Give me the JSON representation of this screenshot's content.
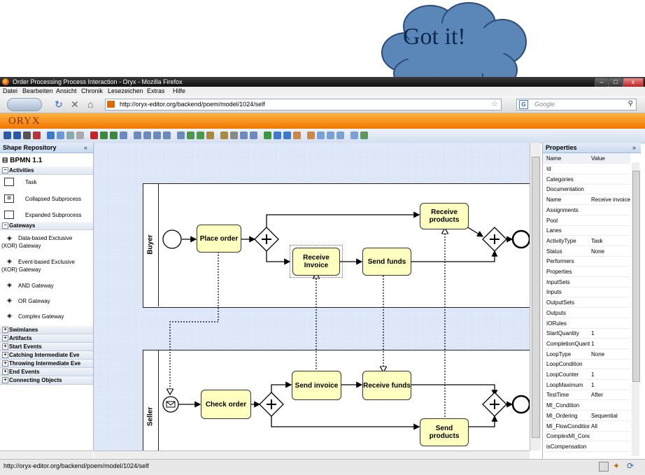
{
  "overlay": {
    "cloud_text": "Got it!"
  },
  "window": {
    "title": "Order Processing Process Interaction - Oryx - Mozilla Firefox",
    "min": "–",
    "max": "□",
    "close": "x"
  },
  "menu": [
    "Datei",
    "Bearbeiten",
    "Ansicht",
    "Chronik",
    "Lesezeichen",
    "Extras",
    "Hilfe"
  ],
  "nav": {
    "url": "http://oryx-editor.org/backend/poem/model/1024/self",
    "search_placeholder": "Google",
    "search_engine": "G"
  },
  "app": {
    "logo": "ORYX"
  },
  "repo": {
    "title": "Shape Repository",
    "collapse": "«",
    "stencil": "BPMN 1.1",
    "sections": {
      "activities": "Activities",
      "gateways": "Gateways",
      "swimlanes": "Swimlanes",
      "artifacts": "Artifacts",
      "start": "Start Events",
      "catching": "Catching Intermediate Eve",
      "throwing": "Throwing Intermediate Eve",
      "end": "End Events",
      "connecting": "Connecting Objects"
    },
    "activity_items": [
      "Task",
      "Collapsed Subprocess",
      "Expanded Subprocess"
    ],
    "gateway_items": [
      "Data-based Exclusive",
      "(XOR) Gateway",
      "Event-based Exclusive",
      "(XOR) Gateway",
      "AND Gateway",
      "OR Gateway",
      "Complex Gateway"
    ]
  },
  "diagram": {
    "pools": [
      "Buyer",
      "Seller"
    ],
    "tasks": {
      "place_order": "Place order",
      "receive_invoice": "Receive Invoice",
      "send_funds": "Send funds",
      "receive_products": "Receive products",
      "check_order": "Check order",
      "send_invoice": "Send invoice",
      "receive_funds": "Receive funds",
      "send_products": "Send products"
    }
  },
  "properties": {
    "title": "Properties",
    "collapse": "»",
    "col_name": "Name",
    "col_value": "Value",
    "rows": [
      [
        "Id",
        ""
      ],
      [
        "Categories",
        ""
      ],
      [
        "Documentation",
        ""
      ],
      [
        "Name",
        "Receive invoice"
      ],
      [
        "Assignments",
        ""
      ],
      [
        "Pool",
        ""
      ],
      [
        "Lanes",
        ""
      ],
      [
        "ActivityType",
        "Task"
      ],
      [
        "Status",
        "None"
      ],
      [
        "Performers",
        ""
      ],
      [
        "Properties",
        ""
      ],
      [
        "InputSets",
        ""
      ],
      [
        "Inputs",
        ""
      ],
      [
        "OutputSets",
        ""
      ],
      [
        "Outputs",
        ""
      ],
      [
        "IORules",
        ""
      ],
      [
        "StartQuantity",
        "1"
      ],
      [
        "CompletionQuanti",
        "1"
      ],
      [
        "LoopType",
        "None"
      ],
      [
        "LoopCondition",
        ""
      ],
      [
        "LoopCounter",
        "1"
      ],
      [
        "LoopMaximum",
        "1"
      ],
      [
        "TestTime",
        "After"
      ],
      [
        "MI_Condition",
        ""
      ],
      [
        "MI_Ordering",
        "Sequential"
      ],
      [
        "MI_FlowCondition",
        "All"
      ],
      [
        "ComplexMI_Cond",
        ""
      ],
      [
        "isCompensation",
        ""
      ]
    ]
  },
  "status": {
    "text": "http://oryx-editor.org/backend/poem/model/1024/self"
  },
  "colors": {
    "oryx_orange": "#f07800",
    "task_fill": "#ffffc0",
    "canvas": "#dfe8f6",
    "cloud": "#5b86b8"
  }
}
